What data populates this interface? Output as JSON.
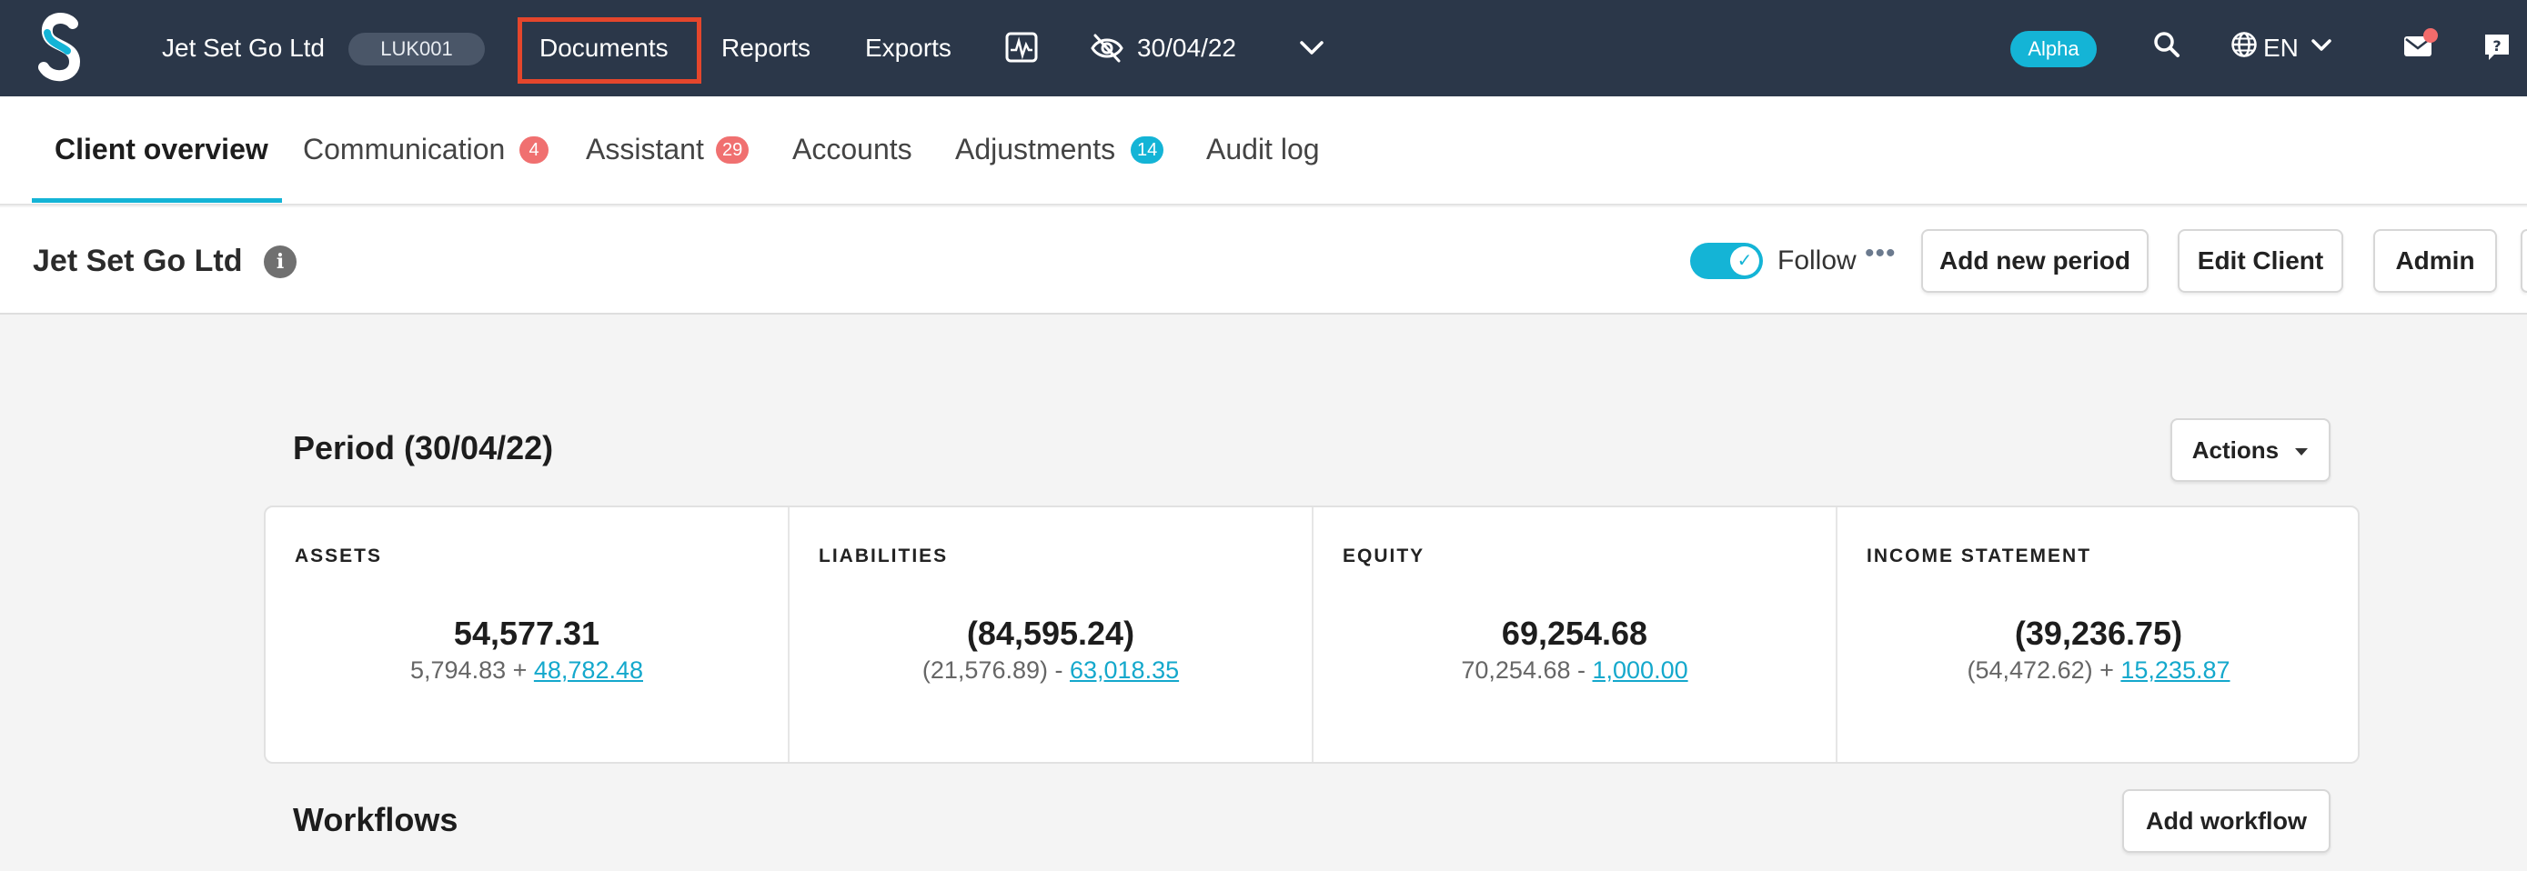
{
  "topnav": {
    "client_name": "Jet Set Go Ltd",
    "client_code": "LUK001",
    "links": {
      "documents": "Documents",
      "reports": "Reports",
      "exports": "Exports"
    },
    "period": "30/04/22",
    "alpha_badge": "Alpha",
    "language": "EN",
    "icons": [
      "logo",
      "activity-monitor-icon",
      "eye-slash-icon",
      "chevron-down-icon",
      "search-icon",
      "globe-icon",
      "mail-icon",
      "help-icon"
    ],
    "notification_color": "#f26b6b"
  },
  "tabs": [
    {
      "label": "Client overview",
      "active": true
    },
    {
      "label": "Communication",
      "count": "4"
    },
    {
      "label": "Assistant",
      "count": "29"
    },
    {
      "label": "Accounts"
    },
    {
      "label": "Adjustments",
      "count": "14"
    },
    {
      "label": "Audit log"
    }
  ],
  "client_header": {
    "title": "Jet Set Go Ltd",
    "follow_label": "Follow",
    "follow_on": true,
    "buttons": {
      "add_period": "Add new period",
      "edit_client": "Edit Client",
      "admin": "Admin"
    }
  },
  "period": {
    "title": "Period (30/04/22)",
    "actions_label": "Actions",
    "stats": [
      {
        "label": "ASSETS",
        "value": "54,577.31",
        "sub_plain": "5,794.83 + ",
        "sub_link": "48,782.48"
      },
      {
        "label": "LIABILITIES",
        "value": "(84,595.24)",
        "sub_plain": "(21,576.89) - ",
        "sub_link": "63,018.35"
      },
      {
        "label": "EQUITY",
        "value": "69,254.68",
        "sub_plain": "70,254.68 - ",
        "sub_link": "1,000.00"
      },
      {
        "label": "INCOME STATEMENT",
        "value": "(39,236.75)",
        "sub_plain": "(54,472.62) + ",
        "sub_link": "15,235.87"
      }
    ]
  },
  "workflows": {
    "title": "Workflows",
    "add_label": "Add workflow"
  },
  "colors": {
    "nav_bg": "#2b3749",
    "accent": "#14b4d6",
    "highlight": "#e5462c",
    "badge_red": "#f07070"
  }
}
